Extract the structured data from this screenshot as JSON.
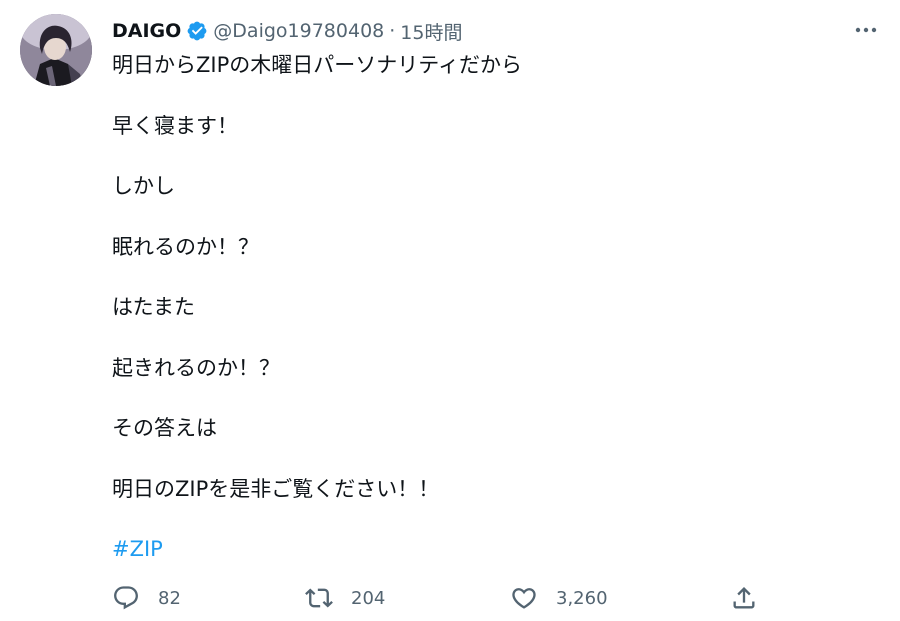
{
  "tweet": {
    "author": {
      "display_name": "DAIGO",
      "handle": "@Daigo19780408",
      "verified": true
    },
    "separator": "·",
    "time": "15時間",
    "lines": [
      "明日からZIPの木曜日パーソナリティだから",
      "早く寝ます！",
      "しかし",
      "眠れるのか！？",
      "はたまた",
      "起きれるのか！？",
      "その答えは",
      "明日のZIPを是非ご覧ください！！"
    ],
    "hashtag": "#ZIP",
    "actions": {
      "reply": {
        "icon": "reply-icon",
        "count": "82"
      },
      "retweet": {
        "icon": "retweet-icon",
        "count": "204"
      },
      "like": {
        "icon": "heart-icon",
        "count": "3,260"
      },
      "share": {
        "icon": "share-icon"
      }
    },
    "colors": {
      "text": "#0f1419",
      "secondary": "#536471",
      "accent": "#1d9bf0"
    }
  }
}
